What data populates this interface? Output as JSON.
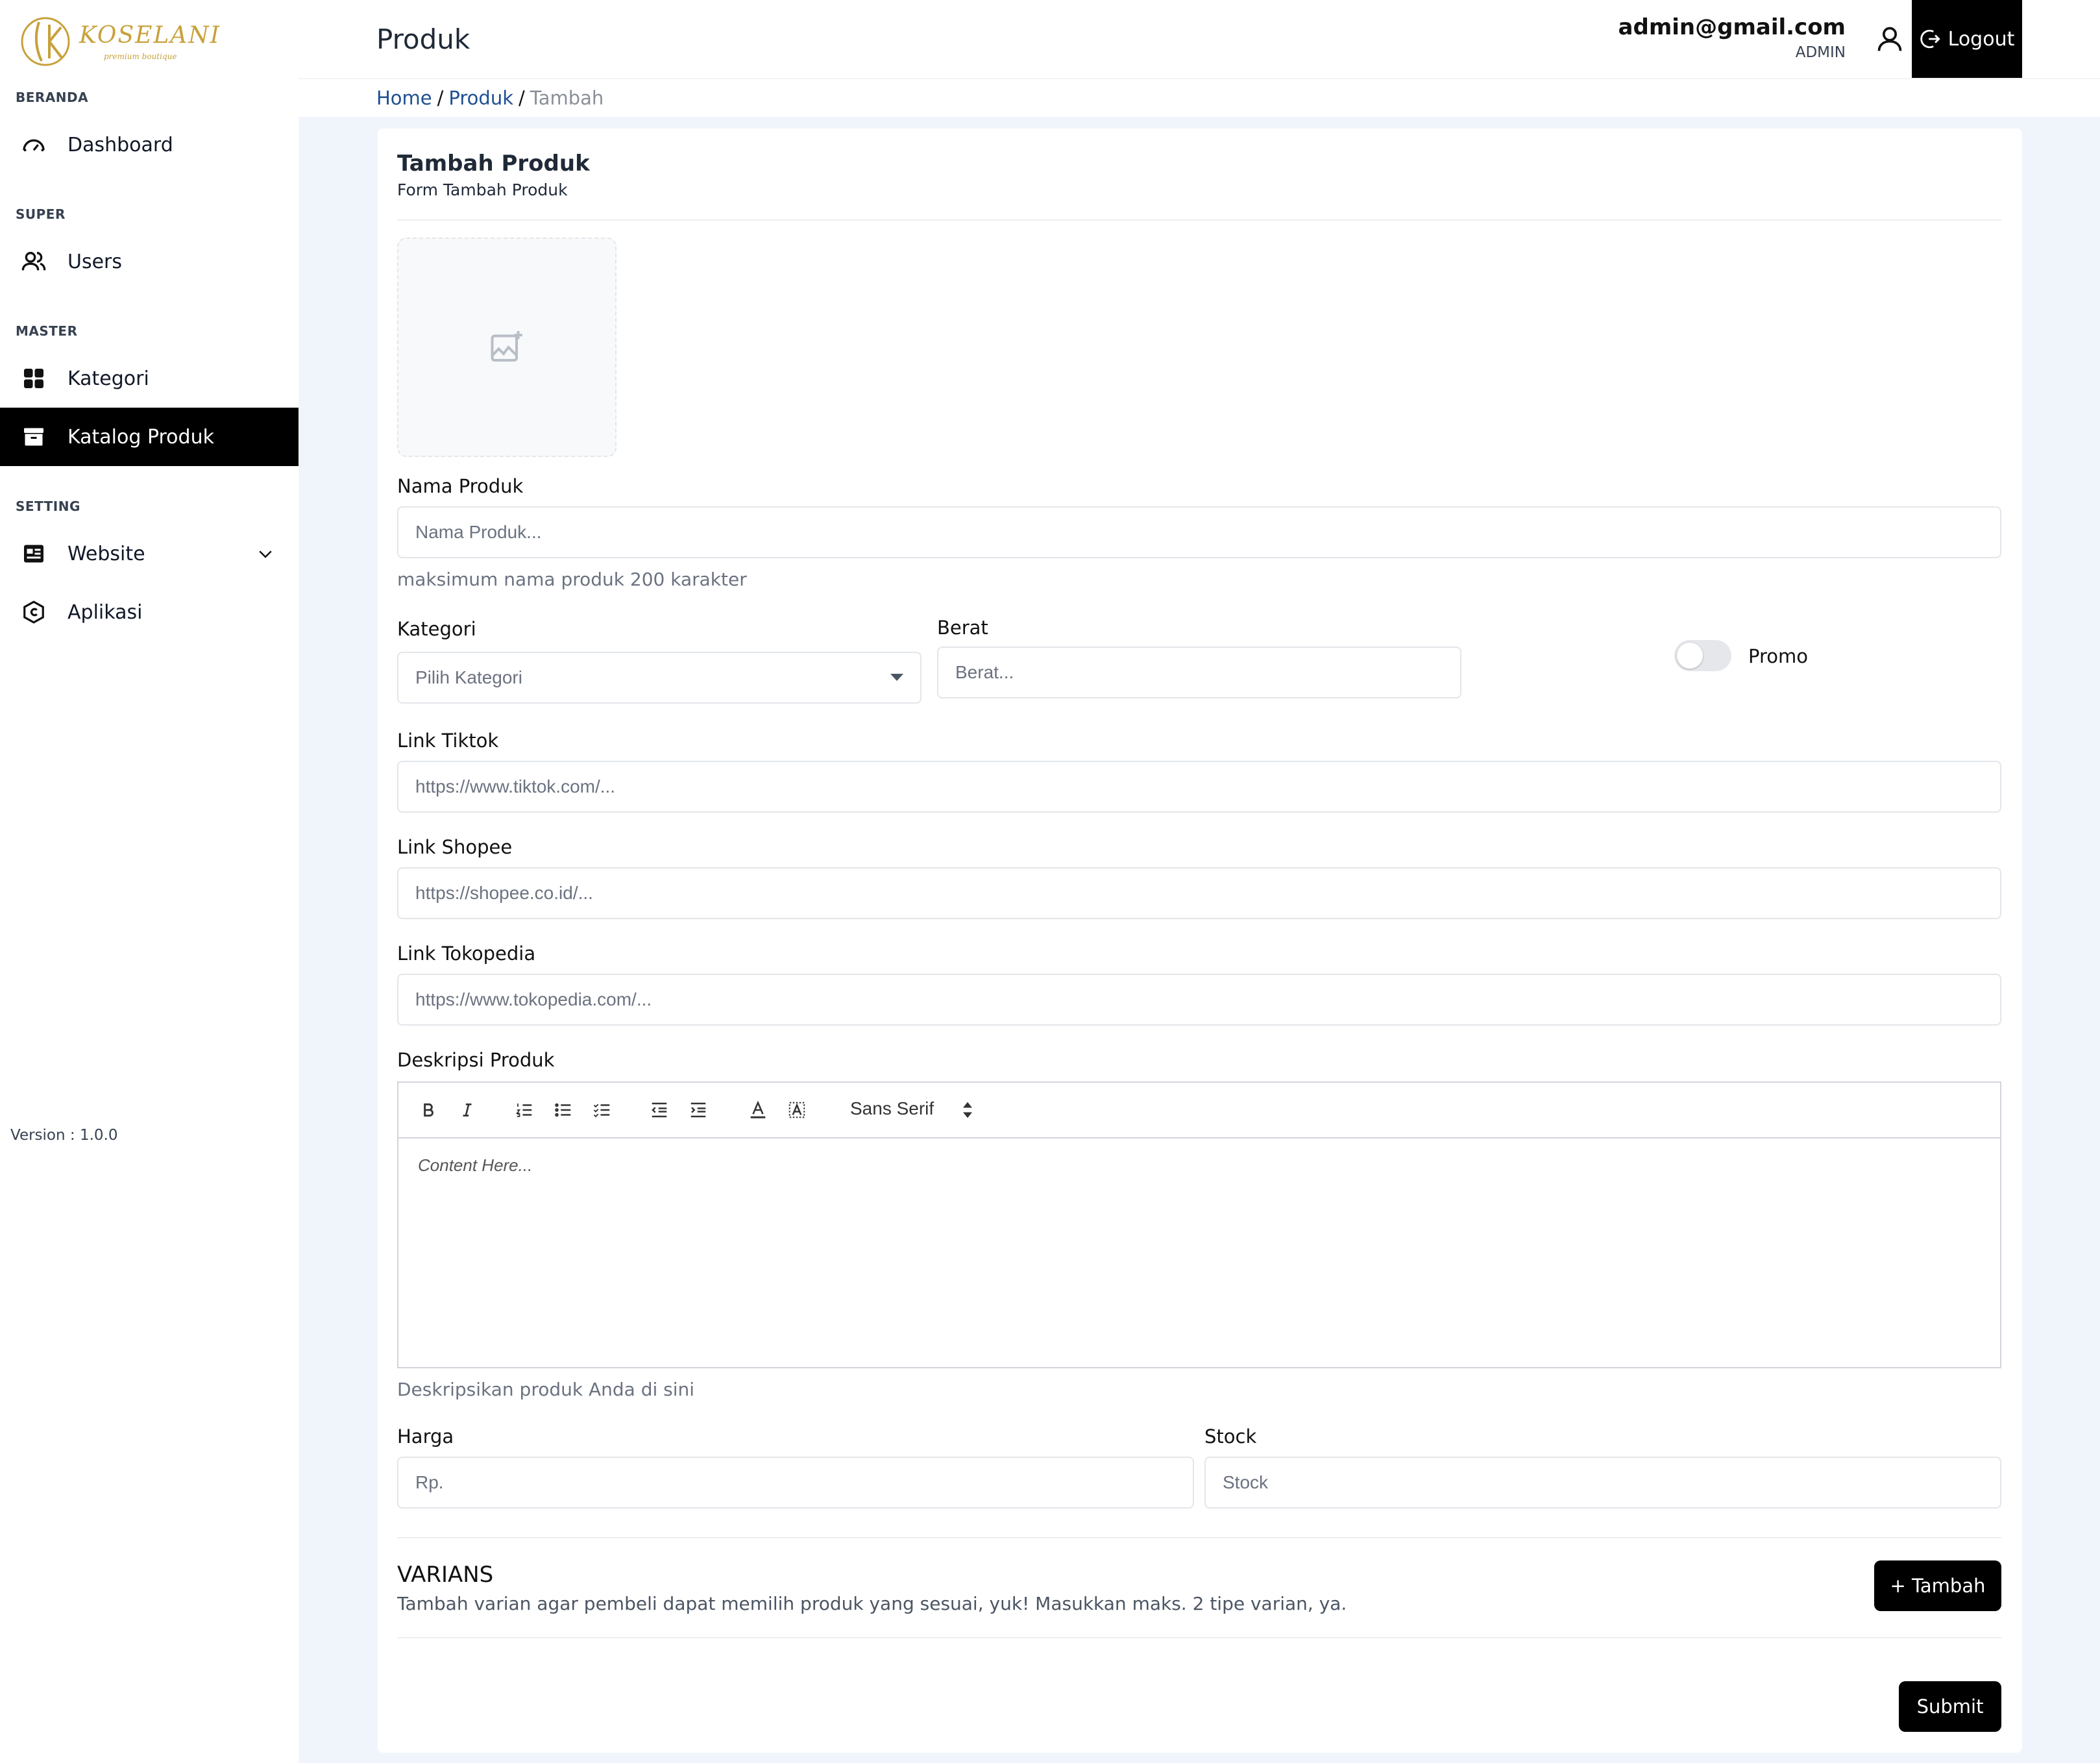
{
  "brand": {
    "logo_text": "KOSELANI",
    "logo_sub": "premium boutique"
  },
  "sidebar": {
    "sections": [
      {
        "title": "BERANDA"
      },
      {
        "title": "SUPER"
      },
      {
        "title": "MASTER"
      },
      {
        "title": "SETTING"
      }
    ],
    "items": [
      {
        "label": "Dashboard",
        "icon": "gauge-icon"
      },
      {
        "label": "Users",
        "icon": "users-icon"
      },
      {
        "label": "Kategori",
        "icon": "grid-icon"
      },
      {
        "label": "Katalog Produk",
        "icon": "archive-icon",
        "active": true
      },
      {
        "label": "Website",
        "icon": "newspaper-icon"
      },
      {
        "label": "Aplikasi",
        "icon": "app-icon"
      }
    ],
    "version": "Version : 1.0.0"
  },
  "header": {
    "title": "Produk",
    "user_email": "admin@gmail.com",
    "user_role": "ADMIN",
    "logout_label": "Logout"
  },
  "breadcrumb": {
    "home": "Home",
    "produk": "Produk",
    "current": "Tambah",
    "sep": "/"
  },
  "form": {
    "title": "Tambah Produk",
    "subtitle": "Form Tambah Produk",
    "nama_label": "Nama Produk",
    "nama_placeholder": "Nama Produk...",
    "nama_help": "maksimum nama produk 200 karakter",
    "kategori_label": "Kategori",
    "kategori_value": "Pilih Kategori",
    "berat_label": "Berat",
    "berat_placeholder": "Berat...",
    "promo_label": "Promo",
    "promo_on": false,
    "tiktok_label": "Link Tiktok",
    "tiktok_placeholder": "https://www.tiktok.com/...",
    "shopee_label": "Link Shopee",
    "shopee_placeholder": "https://shopee.co.id/...",
    "tokopedia_label": "Link Tokopedia",
    "tokopedia_placeholder": "https://www.tokopedia.com/...",
    "deskripsi_label": "Deskripsi Produk",
    "editor_font": "Sans Serif",
    "editor_placeholder": "Content Here...",
    "deskripsi_help": "Deskripsikan produk Anda di sini",
    "harga_label": "Harga",
    "harga_placeholder": "Rp.",
    "stock_label": "Stock",
    "stock_placeholder": "Stock",
    "varians_title": "VARIANS",
    "varians_desc": "Tambah varian agar pembeli dapat memilih produk yang sesuai, yuk! Masukkan maks. 2 tipe varian, ya.",
    "tambah_label": "+ Tambah",
    "submit_label": "Submit"
  },
  "colors": {
    "accent": "#000000",
    "link": "#1e4f91",
    "content_bg": "#f0f5fb",
    "logo_gold": "#c8a13b"
  }
}
